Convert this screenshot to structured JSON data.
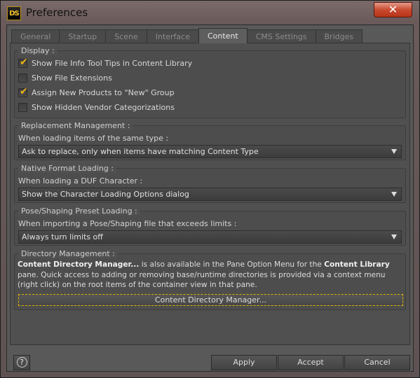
{
  "window": {
    "title": "Preferences",
    "app_icon": "DS",
    "close_glyph": "✕"
  },
  "tabs": [
    {
      "label": "General"
    },
    {
      "label": "Startup"
    },
    {
      "label": "Scene"
    },
    {
      "label": "Interface"
    },
    {
      "label": "Content"
    },
    {
      "label": "CMS Settings"
    },
    {
      "label": "Bridges"
    }
  ],
  "active_tab": "Content",
  "display": {
    "title": "Display :",
    "checkmark": "✔",
    "options": [
      {
        "label": "Show File Info Tool Tips in Content Library",
        "checked": true
      },
      {
        "label": "Show File Extensions",
        "checked": false
      },
      {
        "label": "Assign New Products to \"New\" Group",
        "checked": true
      },
      {
        "label": "Show Hidden Vendor Categorizations",
        "checked": false
      }
    ]
  },
  "replacement": {
    "title": "Replacement Management :",
    "label": "When loading items of the same type :",
    "value": "Ask to replace, only when items have matching Content Type"
  },
  "native": {
    "title": "Native Format Loading :",
    "label": "When loading a DUF Character :",
    "value": "Show the Character Loading Options dialog"
  },
  "pose": {
    "title": "Pose/Shaping Preset Loading :",
    "label": "When importing a Pose/Shaping file that exceeds limits :",
    "value": "Always turn limits off"
  },
  "directory": {
    "title": "Directory Management :",
    "bold1": "Content Directory Manager...",
    "text1": " is also available in the Pane Option Menu for the ",
    "bold2": "Content Library",
    "text2": " pane. Quick access to adding or removing base/runtime directories is provided via a context menu (right click) on the root items of the container view in that pane.",
    "button": "Content Directory Manager..."
  },
  "footer": {
    "help_glyph": "?",
    "apply": "Apply",
    "accept": "Accept",
    "cancel": "Cancel"
  },
  "colors": {
    "accent": "#f2b519",
    "close": "#c84a30"
  }
}
